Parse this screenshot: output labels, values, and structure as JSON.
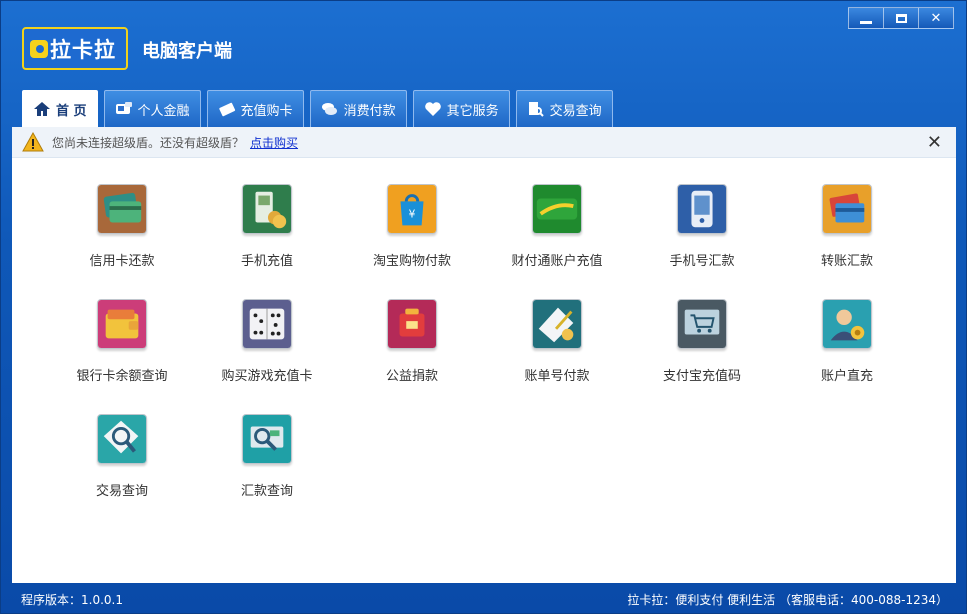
{
  "app": {
    "logo_text": "拉卡拉",
    "title": "电脑客户端"
  },
  "window_controls": {
    "minimize": "minimize",
    "maximize": "maximize",
    "close": "✕"
  },
  "tabs": [
    {
      "label": "首 页",
      "icon": "home-icon",
      "active": true
    },
    {
      "label": "个人金融",
      "icon": "card-reader-icon",
      "active": false
    },
    {
      "label": "充值购卡",
      "icon": "card-icon",
      "active": false
    },
    {
      "label": "消费付款",
      "icon": "coins-icon",
      "active": false
    },
    {
      "label": "其它服务",
      "icon": "heart-icon",
      "active": false
    },
    {
      "label": "交易查询",
      "icon": "search-doc-icon",
      "active": false
    }
  ],
  "notice": {
    "text": "您尚未连接超级盾。还没有超级盾？",
    "link": "点击购买",
    "close": "✕"
  },
  "services": [
    {
      "label": "信用卡还款",
      "icon": "credit-card-icon"
    },
    {
      "label": "手机充值",
      "icon": "mobile-topup-icon"
    },
    {
      "label": "淘宝购物付款",
      "icon": "shopping-bag-icon"
    },
    {
      "label": "财付通账户充值",
      "icon": "tenpay-icon"
    },
    {
      "label": "手机号汇款",
      "icon": "phone-transfer-icon"
    },
    {
      "label": "转账汇款",
      "icon": "transfer-icon"
    },
    {
      "label": "银行卡余额查询",
      "icon": "wallet-icon"
    },
    {
      "label": "购买游戏充值卡",
      "icon": "dice-icon"
    },
    {
      "label": "公益捐款",
      "icon": "donation-icon"
    },
    {
      "label": "账单号付款",
      "icon": "bill-icon"
    },
    {
      "label": "支付宝充值码",
      "icon": "cart-icon"
    },
    {
      "label": "账户直充",
      "icon": "account-icon"
    },
    {
      "label": "交易查询",
      "icon": "magnifier-icon"
    },
    {
      "label": "汇款查询",
      "icon": "remit-query-icon"
    }
  ],
  "status": {
    "version": "程序版本：1.0.0.1",
    "slogan": "拉卡拉：便利支付 便利生活 （客服电话：400-088-1234）"
  }
}
